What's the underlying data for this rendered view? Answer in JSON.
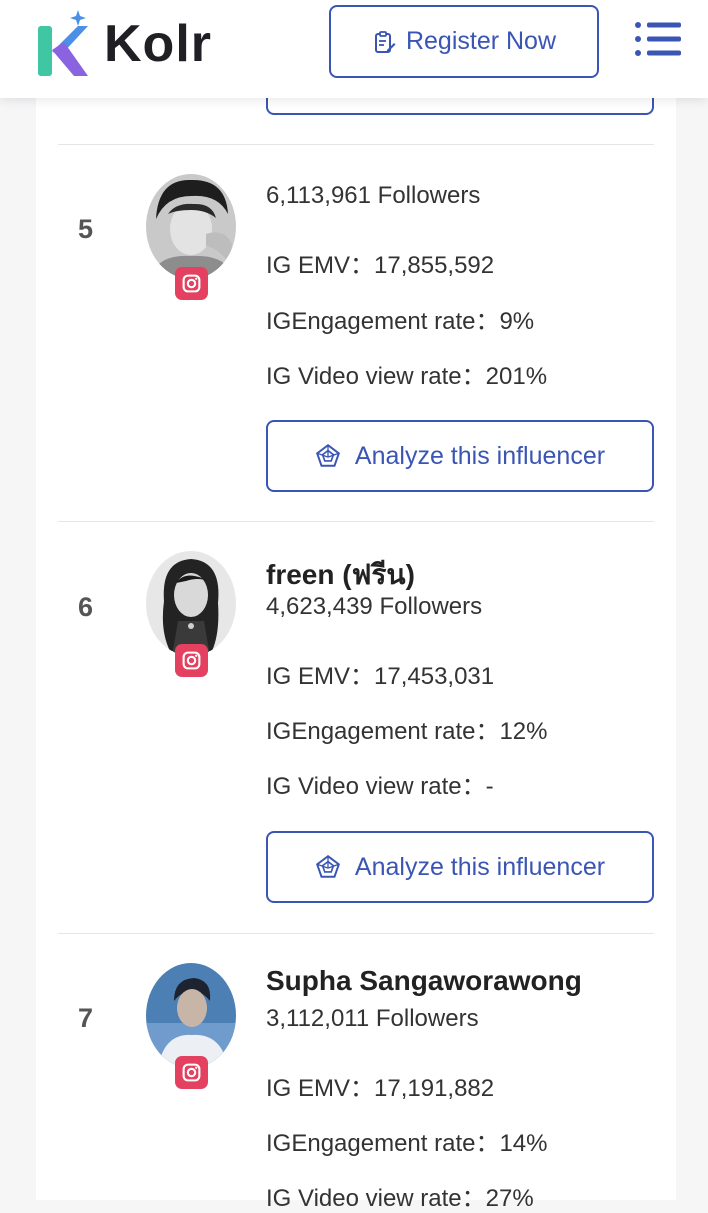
{
  "header": {
    "logo_text": "Kolr",
    "register_label": "Register Now",
    "menu_icon": "hamburger-menu-icon"
  },
  "colors": {
    "accent": "#3a55b4",
    "instagram": "#e4405f"
  },
  "influencers": [
    {
      "rank": "5",
      "name": "",
      "followers": "6,113,961 Followers",
      "emv": "IG EMV：17,855,592",
      "engagement": "IGEngagement rate：9%",
      "video_view": "IG Video view rate：201%",
      "analyze_label": "Analyze this influencer"
    },
    {
      "rank": "6",
      "name": "freen (ฟรีน)",
      "followers": "4,623,439 Followers",
      "emv": "IG EMV：17,453,031",
      "engagement": "IGEngagement rate：12%",
      "video_view": "IG Video view rate：-",
      "analyze_label": "Analyze this influencer"
    },
    {
      "rank": "7",
      "name": "Supha Sangaworawong",
      "followers": "3,112,011 Followers",
      "emv": "IG EMV：17,191,882",
      "engagement": "IGEngagement rate：14%",
      "video_view": "IG Video view rate：27%"
    }
  ]
}
